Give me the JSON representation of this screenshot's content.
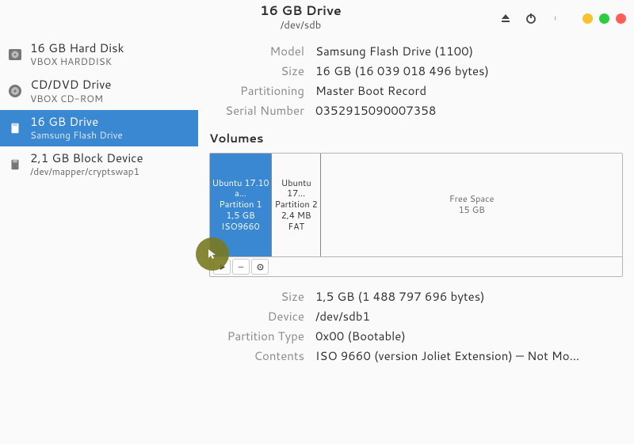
{
  "header": {
    "title": "16 GB Drive",
    "subtitle": "/dev/sdb"
  },
  "sidebar": {
    "items": [
      {
        "name": "16 GB Hard Disk",
        "sub": "VBOX HARDDISK",
        "icon": "harddisk-icon"
      },
      {
        "name": "CD/DVD Drive",
        "sub": "VBOX CD-ROM",
        "icon": "optical-icon"
      },
      {
        "name": "16 GB Drive",
        "sub": "Samsung Flash Drive",
        "icon": "removable-icon"
      },
      {
        "name": "2,1 GB Block Device",
        "sub": "/dev/mapper/cryptswap1",
        "icon": "removable-icon"
      }
    ],
    "selected_index": 2
  },
  "details": {
    "model_label": "Model",
    "model": "Samsung Flash Drive (1100)",
    "size_label": "Size",
    "size": "16 GB (16 039 018 496 bytes)",
    "part_label": "Partitioning",
    "partitioning": "Master Boot Record",
    "serial_label": "Serial Number",
    "serial": "0352915090007358"
  },
  "volumes_title": "Volumes",
  "volumes": {
    "parts": [
      {
        "l1": "Ubuntu 17.10 a…",
        "l2": "Partition 1",
        "l3": "1,5 GB ISO9660",
        "w": 15,
        "sel": true
      },
      {
        "l1": "Ubuntu 17…",
        "l2": "Partition 2",
        "l3": "2,4 MB FAT",
        "w": 12,
        "sel": false
      },
      {
        "l1": "Free Space",
        "l2": "15 GB",
        "l3": "",
        "w": 73,
        "sel": false,
        "free": true
      }
    ]
  },
  "partition": {
    "size_label": "Size",
    "size": "1,5 GB (1 488 797 696 bytes)",
    "device_label": "Device",
    "device": "/dev/sdb1",
    "type_label": "Partition Type",
    "type": "0x00 (Bootable)",
    "contents_label": "Contents",
    "contents": "ISO 9660 (version Joliet Extension) — Not Mo…"
  }
}
